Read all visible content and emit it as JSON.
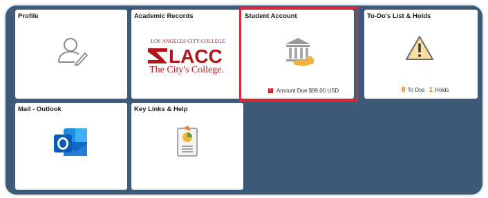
{
  "tiles": {
    "profile": {
      "title": "Profile",
      "icon": "user-edit-icon"
    },
    "academic_records": {
      "title": "Academic Records",
      "logo_top": "LOS ANGELES CITY COLLEGE",
      "logo_mid": "LACC",
      "logo_bottom": "The City's College.",
      "colors": {
        "brand_red": "#b3141c"
      }
    },
    "student_account": {
      "title": "Student Account",
      "icon": "bank-payment-icon",
      "amount_text": "Amount Due $99.00 USD",
      "alert_icon": "alert-flag-icon"
    },
    "todos_holds": {
      "title": "To-Do's List & Holds",
      "icon": "warning-triangle-icon",
      "todo_count": "8",
      "todo_label": "To Dos",
      "holds_count": "1",
      "holds_label": "Holds"
    },
    "mail_outlook": {
      "title": "Mail - Outlook",
      "icon": "outlook-icon"
    },
    "key_links": {
      "title": "Key Links & Help",
      "icon": "document-chart-icon"
    }
  },
  "colors": {
    "panel_bg": "#3d5a79",
    "highlight": "#d42e3a",
    "accent_orange": "#d9771a"
  }
}
